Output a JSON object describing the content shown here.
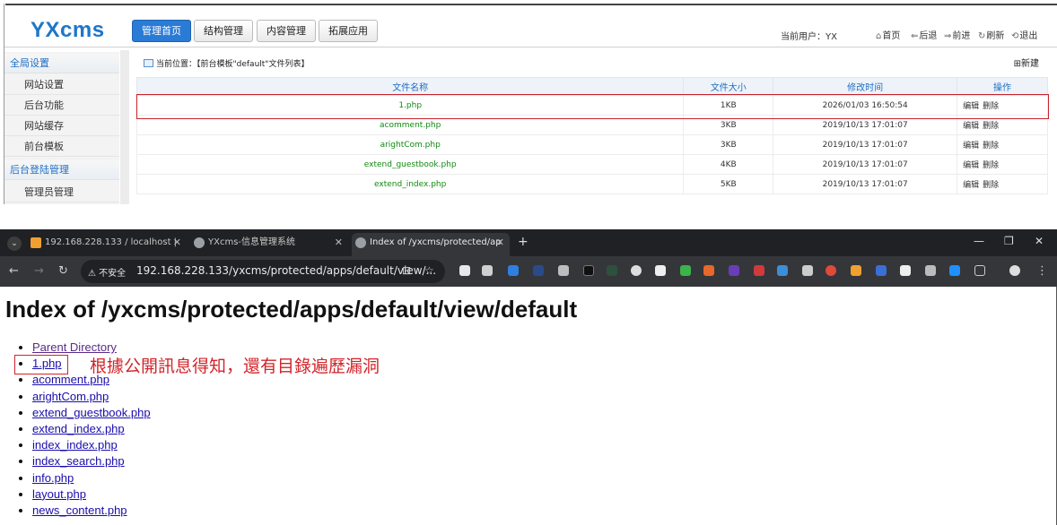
{
  "cms": {
    "logo": "YXcms",
    "nav": [
      "管理首页",
      "结构管理",
      "内容管理",
      "拓展应用"
    ],
    "current_user": "当前用户：YX",
    "tools": {
      "home": "首页",
      "back": "后退",
      "forward": "前进",
      "refresh": "刷新",
      "logout": "退出"
    },
    "sidebar": {
      "group1": "全局设置",
      "items1": [
        "网站设置",
        "后台功能",
        "网站缓存",
        "前台模板"
      ],
      "group2": "后台登陆管理",
      "items2": [
        "管理员管理"
      ]
    },
    "breadcrumb": "当前位置：【前台模板\"default\"文件列表】",
    "new_label": "新建",
    "table": {
      "headers": [
        "文件名称",
        "文件大小",
        "修改时间",
        "操作"
      ],
      "edit": "编辑",
      "delete": "删除",
      "rows": [
        {
          "name": "1.php",
          "size": "1KB",
          "time": "2026/01/03 16:50:54"
        },
        {
          "name": "acomment.php",
          "size": "3KB",
          "time": "2019/10/13 17:01:07"
        },
        {
          "name": "arightCom.php",
          "size": "3KB",
          "time": "2019/10/13 17:01:07"
        },
        {
          "name": "extend_guestbook.php",
          "size": "4KB",
          "time": "2019/10/13 17:01:07"
        },
        {
          "name": "extend_index.php",
          "size": "5KB",
          "time": "2019/10/13 17:01:07"
        }
      ]
    }
  },
  "browser": {
    "tabs": [
      {
        "title": "192.168.228.133 / localhost |",
        "icon_color": "#f0a030"
      },
      {
        "title": "YXcms-信息管理系统",
        "icon_color": "#9aa0a6"
      },
      {
        "title": "Index of /yxcms/protected/ap",
        "icon_color": "#9aa0a6"
      }
    ],
    "insecure_label": "不安全",
    "url": "192.168.228.133/yxcms/protected/apps/default/view/...",
    "page": {
      "heading": "Index of /yxcms/protected/apps/default/view/default",
      "links": [
        "Parent Directory",
        "1.php",
        "acomment.php",
        "arightCom.php",
        "extend_guestbook.php",
        "extend_index.php",
        "index_index.php",
        "index_search.php",
        "info.php",
        "layout.php",
        "news_content.php"
      ],
      "annotation": "根據公開訊息得知，還有目錄遍歷漏洞"
    }
  },
  "colors": {
    "accent": "#1f76c8",
    "highlight": "#d2242a",
    "filename_green": "#108a10"
  }
}
